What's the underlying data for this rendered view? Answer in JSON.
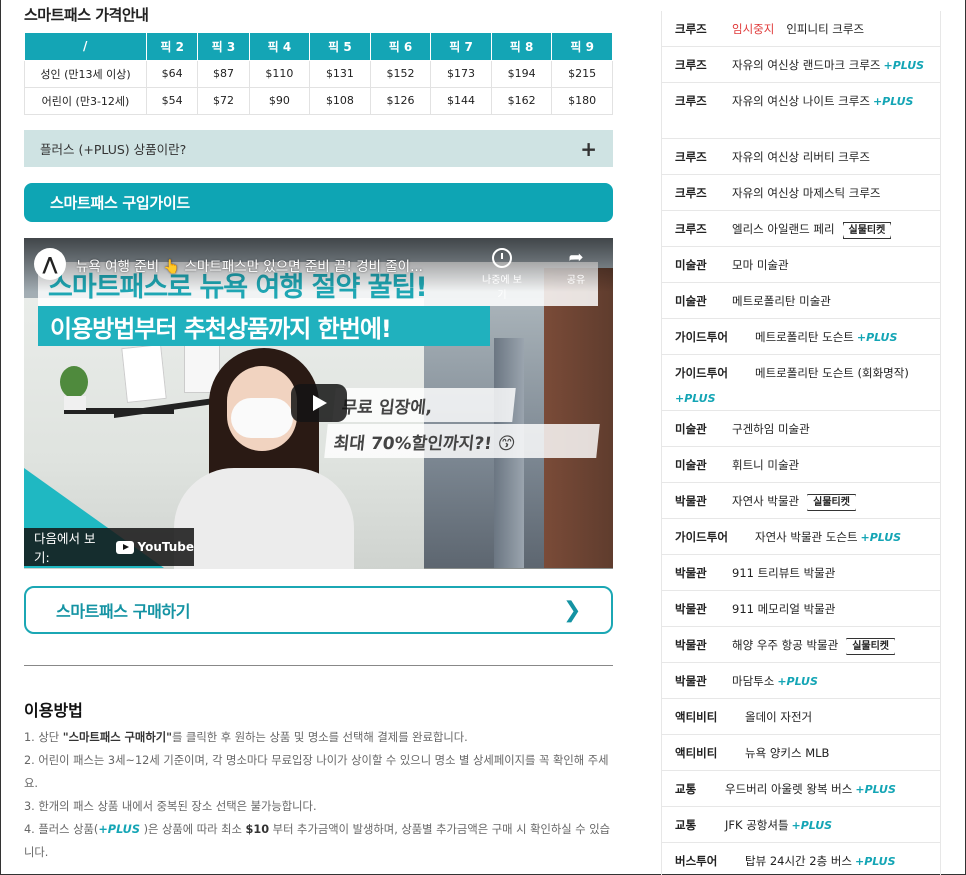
{
  "price": {
    "title": "스마트패스 가격안내",
    "headers": [
      "/",
      "픽 2",
      "픽 3",
      "픽 4",
      "픽 5",
      "픽 6",
      "픽 7",
      "픽 8",
      "픽 9"
    ],
    "rows": [
      [
        "성인 (만13세 이상)",
        "$64",
        "$87",
        "$110",
        "$131",
        "$152",
        "$173",
        "$194",
        "$215"
      ],
      [
        "어린이 (만3-12세)",
        "$54",
        "$72",
        "$90",
        "$108",
        "$126",
        "$144",
        "$162",
        "$180"
      ]
    ]
  },
  "plus_faq": {
    "label": "플러스 (+PLUS) 상품이란?",
    "toggle": "+"
  },
  "guide_title": "스마트패스 구입가이드",
  "video": {
    "title": "뉴욕 여행 준비 👆 스마트패스만 있으면 준비 끝! 경비 줄이...",
    "watch_later": "나중에 보기",
    "share": "공유",
    "banner1": "스마트패스로 뉴욕 여행 절약 꿀팁!",
    "banner2": "이용방법부터 추천상품까지 한번에!",
    "caption1": "무료 입장에,",
    "caption2": "최대 70%할인까지?! 😙",
    "watch_on": "다음에서 보기:",
    "youtube": "YouTube"
  },
  "buy_button": {
    "label": "스마트패스 구매하기",
    "icon": "chevron-right-icon"
  },
  "usage": {
    "title": "이용방법",
    "items": [
      {
        "pre": "1. 상단 ",
        "bold": "\"스마트패스 구매하기\"",
        "post": "를 클릭한 후 원하는 상품 및 명소를 선택해 결제를 완료합니다."
      },
      {
        "pre": "2. 어린이 패스는 3세~12세 기준이며, 각 명소마다 무료입장 나이가 상이할 수 있으니 명소 별 상세페이지를 꼭 확인해 주세요.",
        "bold": "",
        "post": ""
      },
      {
        "pre": "3. 한개의 패스 상품 내에서 중복된 장소 선택은 불가능합니다.",
        "bold": "",
        "post": ""
      },
      {
        "pre": "4. 플러스 상품(",
        "plus": "+PLUS",
        "mid": " )은 상품에 따라 최소 ",
        "bold": "$10",
        "post": " 부터 추가금액이 발생하며, 상품별 추가금액은 구매 시 확인하실 수 있습니다."
      }
    ]
  },
  "plus_tag": "+PLUS",
  "ticket_tag": "실물티켓",
  "attractions": [
    {
      "cat": "크루즈",
      "badge": "임시중지",
      "name": "인피니티 크루즈",
      "plus": false,
      "ticket": false,
      "h": 36
    },
    {
      "cat": "크루즈",
      "name": "자유의 여신상 랜드마크 크루즈",
      "plus": true,
      "ticket": false,
      "h": 36
    },
    {
      "cat": "크루즈",
      "name": "자유의 여신상 나이트 크루즈",
      "plus": true,
      "ticket": false,
      "h": 56
    },
    {
      "cat": "크루즈",
      "name": "자유의 여신상 리버티 크루즈",
      "plus": false,
      "ticket": false,
      "h": 36
    },
    {
      "cat": "크루즈",
      "name": "자유의 여신상 마제스틱 크루즈",
      "plus": false,
      "ticket": false,
      "h": 36
    },
    {
      "cat": "크루즈",
      "name": "엘리스 아일랜드 페리",
      "plus": false,
      "ticket": true,
      "h": 36
    },
    {
      "cat": "미술관",
      "name": "모마 미술관",
      "plus": false,
      "ticket": false,
      "h": 36
    },
    {
      "cat": "미술관",
      "name": "메트로폴리탄 미술관",
      "plus": false,
      "ticket": false,
      "h": 36
    },
    {
      "cat": "가이드투어",
      "name": "메트로폴리탄 도슨트",
      "plus": true,
      "ticket": false,
      "h": 36
    },
    {
      "cat": "가이드투어",
      "name": "메트로폴리탄 도슨트 (회화명작)",
      "plus": true,
      "wrap": true,
      "ticket": false,
      "h": 56
    },
    {
      "cat": "미술관",
      "name": "구겐하임 미술관",
      "plus": false,
      "ticket": false,
      "h": 36
    },
    {
      "cat": "미술관",
      "name": "휘트니 미술관",
      "plus": false,
      "ticket": false,
      "h": 36
    },
    {
      "cat": "박물관",
      "name": "자연사 박물관",
      "plus": false,
      "ticket": true,
      "h": 36
    },
    {
      "cat": "가이드투어",
      "name": "자연사 박물관 도슨트",
      "plus": true,
      "ticket": false,
      "h": 36
    },
    {
      "cat": "박물관",
      "name": "911 트리뷰트 박물관",
      "plus": false,
      "ticket": false,
      "h": 36
    },
    {
      "cat": "박물관",
      "name": "911 메모리얼 박물관",
      "plus": false,
      "ticket": false,
      "h": 36
    },
    {
      "cat": "박물관",
      "name": "해양 우주 항공 박물관",
      "plus": false,
      "ticket": true,
      "h": 36
    },
    {
      "cat": "박물관",
      "name": "마담투소",
      "plus": true,
      "ticket": false,
      "h": 36
    },
    {
      "cat": "액티비티",
      "name": "올데이 자전거",
      "plus": false,
      "ticket": false,
      "h": 36
    },
    {
      "cat": "액티비티",
      "name": "뉴욕 양키스 MLB",
      "plus": false,
      "ticket": false,
      "h": 36
    },
    {
      "cat": "교통",
      "name": "우드버리 아울렛 왕복 버스",
      "plus": true,
      "ticket": false,
      "h": 36
    },
    {
      "cat": "교통",
      "name": "JFK 공항셔틀",
      "plus": true,
      "ticket": false,
      "h": 36
    },
    {
      "cat": "버스투어",
      "name": "탑뷰 24시간 2층 버스",
      "plus": true,
      "ticket": false,
      "h": 36
    }
  ]
}
